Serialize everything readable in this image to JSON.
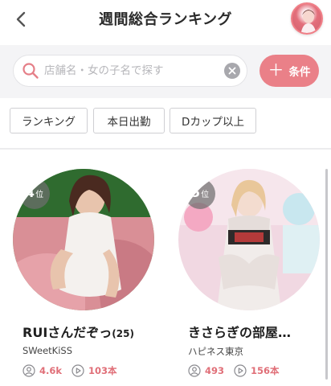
{
  "header": {
    "title": "週間総合ランキング"
  },
  "search": {
    "placeholder": "店舗名・女の子名で探す",
    "condition_label": "条件"
  },
  "filters": [
    "ランキング",
    "本日出勤",
    "Dカップ以上"
  ],
  "cards": [
    {
      "rank": "4",
      "rank_suffix": "位",
      "name": "RUIさんだぞっ",
      "age": "(25)",
      "shop": "SWeetKiSS",
      "views": "4.6k",
      "videos": "103本"
    },
    {
      "rank": "5",
      "rank_suffix": "位",
      "name": "きさらぎの部屋…",
      "age": "",
      "shop": "ハピネス東京",
      "views": "493",
      "videos": "156本"
    }
  ],
  "colors": {
    "accent": "#ea8088",
    "stat_text": "#e06f78"
  },
  "icons": {
    "back": "chevron-left-icon",
    "search": "search-icon",
    "clear": "close-icon",
    "add": "plus-icon",
    "views": "user-icon",
    "videos": "play-icon"
  }
}
